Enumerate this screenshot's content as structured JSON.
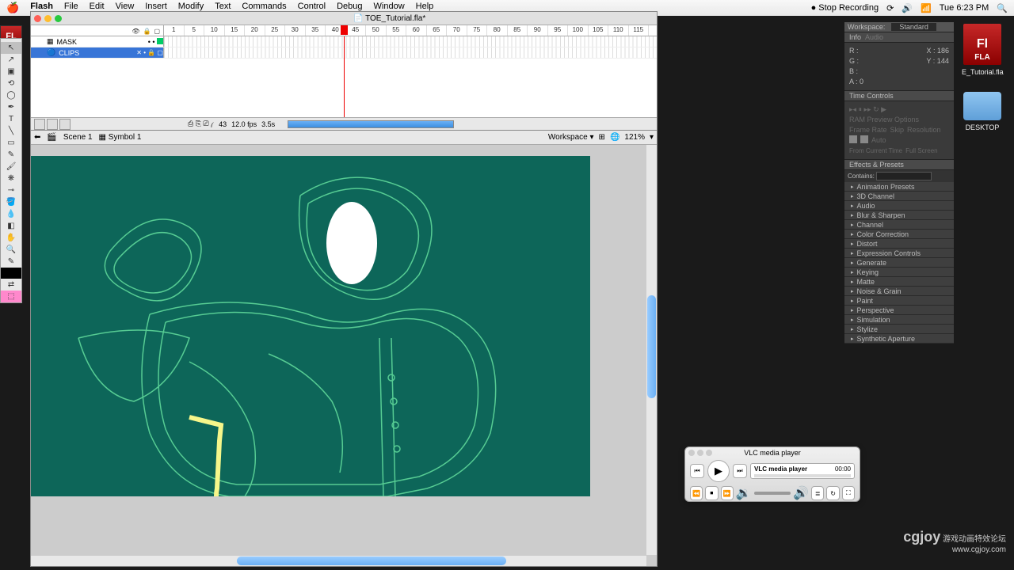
{
  "menubar": {
    "app": "Flash",
    "items": [
      "File",
      "Edit",
      "View",
      "Insert",
      "Modify",
      "Text",
      "Commands",
      "Control",
      "Debug",
      "Window",
      "Help"
    ],
    "right": {
      "stop": "Stop Recording",
      "clock": "Tue 6:23 PM"
    }
  },
  "document": {
    "tab": "TOE_Tutorial.fla*",
    "scene": "Scene 1",
    "symbol": "Symbol 1",
    "workspace_label": "Workspace ▾",
    "zoom": "121%"
  },
  "timeline": {
    "layers": [
      {
        "name": "MASK"
      },
      {
        "name": "CLIPS"
      }
    ],
    "frame_marks": [
      "1",
      "5",
      "10",
      "15",
      "20",
      "25",
      "30",
      "35",
      "40",
      "45",
      "50",
      "55",
      "60",
      "65",
      "70",
      "75",
      "80",
      "85",
      "90",
      "95",
      "100",
      "105",
      "110",
      "115"
    ],
    "status": {
      "frame": "43",
      "fps": "12.0 fps",
      "time": "3.5s"
    }
  },
  "top_workspace": {
    "label": "Workspace:",
    "value": "Standard"
  },
  "info_panel": {
    "tabs": [
      "Info",
      "Audio"
    ],
    "rgb": {
      "r": "R :",
      "g": "G :",
      "b": "B :",
      "a": "A :  0"
    },
    "x": "X : 186",
    "y": "Y :  144"
  },
  "time_controls": {
    "title": "Time Controls",
    "ram": "RAM Preview Options",
    "fr": "Frame Rate",
    "skip": "Skip",
    "res": "Resolution",
    "auto": "Auto",
    "from": "From Current Time",
    "full": "Full Screen"
  },
  "effects": {
    "title": "Effects & Presets",
    "contains": "Contains:",
    "items": [
      "Animation Presets",
      "3D Channel",
      "Audio",
      "Blur & Sharpen",
      "Channel",
      "Color Correction",
      "Distort",
      "Expression Controls",
      "Generate",
      "Keying",
      "Matte",
      "Noise & Grain",
      "Paint",
      "Perspective",
      "Simulation",
      "Stylize",
      "Synthetic Aperture"
    ]
  },
  "desktop": {
    "file": "E_Tutorial.fla",
    "folder": "DESKTOP"
  },
  "vlc": {
    "title": "VLC media player",
    "track": "VLC media player",
    "time": "00:00"
  },
  "watermark": {
    "brand": "cgjoy",
    "tag": "游戏动画特效论坛",
    "url": "www.cgjoy.com"
  }
}
